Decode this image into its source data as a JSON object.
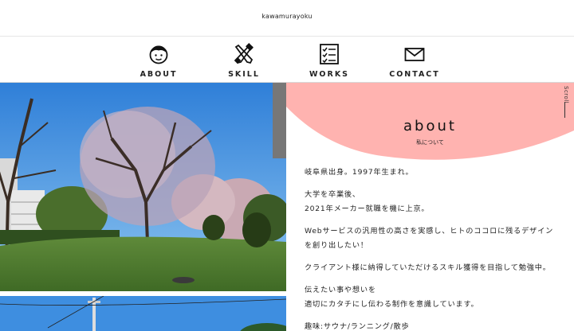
{
  "header": {
    "site_title": "kawamurayoku"
  },
  "nav": {
    "items": [
      {
        "label": "ABOUT",
        "icon": "face-icon"
      },
      {
        "label": "SKILL",
        "icon": "tools-icon"
      },
      {
        "label": "WORKS",
        "icon": "checklist-icon"
      },
      {
        "label": "CONTACT",
        "icon": "mail-icon"
      }
    ]
  },
  "about": {
    "title": "about",
    "subtitle": "私について",
    "scroll_label": "Scroll",
    "paragraphs": [
      [
        "岐阜県出身。1997年生まれ。"
      ],
      [
        "大学を卒業後、",
        "2021年メーカー就職を機に上京。"
      ],
      [
        "Webサービスの汎用性の高さを実感し、ヒトのココロに残るデザイン",
        "を創り出したい！"
      ],
      [
        "クライアント様に納得していただけるスキル獲得を目指して勉強中。"
      ],
      [
        "伝えたい事や想いを",
        "適切にカタチにし伝わる制作を意識しています。"
      ],
      [
        "趣味:サウナ/ランニング/散歩"
      ]
    ]
  },
  "colors": {
    "accent_pink": "#ffb3b0",
    "text": "#222222"
  }
}
